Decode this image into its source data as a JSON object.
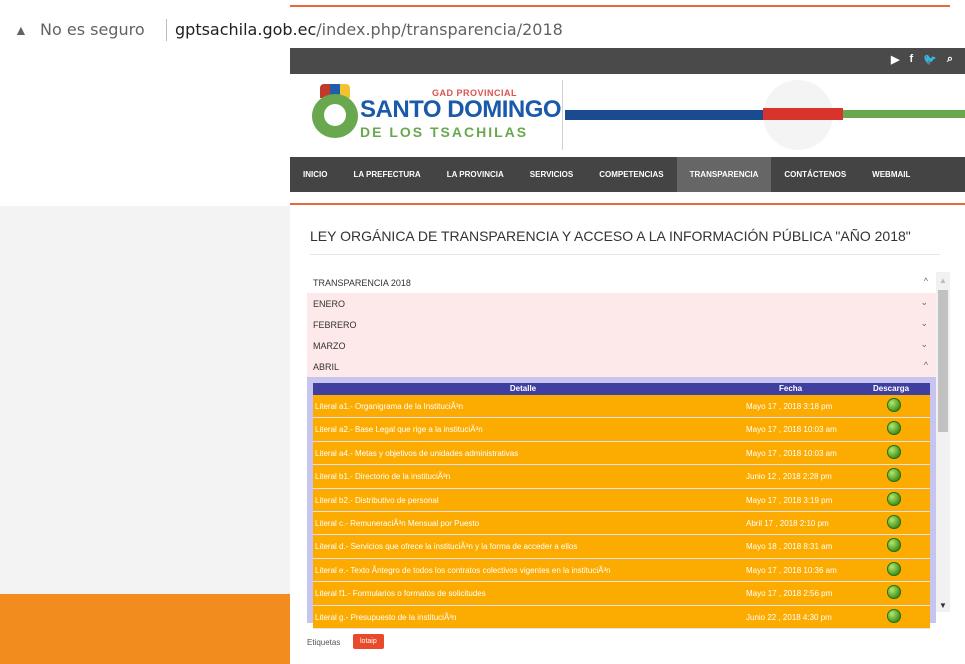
{
  "browser": {
    "security_label": "No es seguro",
    "url_host": "gptsachila.gob.ec",
    "url_path": "/index.php/transparencia/2018"
  },
  "topbar": {
    "icons": [
      "youtube-icon",
      "facebook-icon",
      "twitter-icon",
      "search-icon"
    ]
  },
  "logo": {
    "line1": "GAD PROVINCIAL",
    "line2": "SANTO DOMINGO",
    "line3": "DE LOS TSACHILAS"
  },
  "nav": {
    "items": [
      {
        "label": "INICIO"
      },
      {
        "label": "LA PREFECTURA"
      },
      {
        "label": "LA PROVINCIA"
      },
      {
        "label": "SERVICIOS"
      },
      {
        "label": "COMPETENCIAS"
      },
      {
        "label": "TRANSPARENCIA",
        "active": true
      },
      {
        "label": "CONTÁCTENOS"
      },
      {
        "label": "WEBMAIL"
      }
    ]
  },
  "page": {
    "title": "LEY ORGÁNICA DE TRANSPARENCIA Y ACCESO A LA INFORMACIÓN PÚBLICA \"AÑO 2018\""
  },
  "accordion": {
    "header": "TRANSPARENCIA 2018",
    "months": [
      {
        "label": "ENERO",
        "state": "collapsed"
      },
      {
        "label": "FEBRERO",
        "state": "collapsed"
      },
      {
        "label": "MARZO",
        "state": "collapsed"
      },
      {
        "label": "ABRIL",
        "state": "expanded"
      }
    ]
  },
  "table": {
    "headers": {
      "detail": "Detalle",
      "date": "Fecha",
      "download": "Descarga"
    },
    "rows": [
      {
        "detail": "Literal a1.- Organigrama de la InstituciÃ³n",
        "date": "Mayo 17 , 2018 3:18 pm"
      },
      {
        "detail": "Literal a2.- Base Legal que rige a la instituciÃ³n",
        "date": "Mayo 17 , 2018 10:03 am"
      },
      {
        "detail": "Literal a4.- Metas y objetivos de unidades administrativas",
        "date": "Mayo 17 , 2018 10:03 am"
      },
      {
        "detail": "Literal b1.- Directorio de la instituciÃ³n",
        "date": "Junio 12 , 2018 2:28 pm"
      },
      {
        "detail": "Literal b2.- Distributivo de personal",
        "date": "Mayo 17 , 2018 3:19 pm"
      },
      {
        "detail": "Literal c.- RemuneraciÃ³n Mensual por Puesto",
        "date": "Abril 17 , 2018 2:10 pm"
      },
      {
        "detail": "Literal d.- Servicios que ofrece la instituciÃ³n y la forma de acceder a ellos",
        "date": "Mayo 18 , 2018 8:31 am"
      },
      {
        "detail": "Literal e.- Texto Ãntegro de todos los contratos colectivos vigentes en la instituciÃ³n",
        "date": "Mayo 17 , 2018 10:36 am"
      },
      {
        "detail": "Literal f1.- Formularios o formatos de solicitudes",
        "date": "Mayo 17 , 2018 2:56 pm"
      },
      {
        "detail": "Literal g.- Presupuesto de la instituciÃ³n",
        "date": "Junio 22 , 2018 4:30 pm"
      }
    ]
  },
  "footer": {
    "tags_label": "Etiquetas",
    "tag": "lotaip"
  }
}
